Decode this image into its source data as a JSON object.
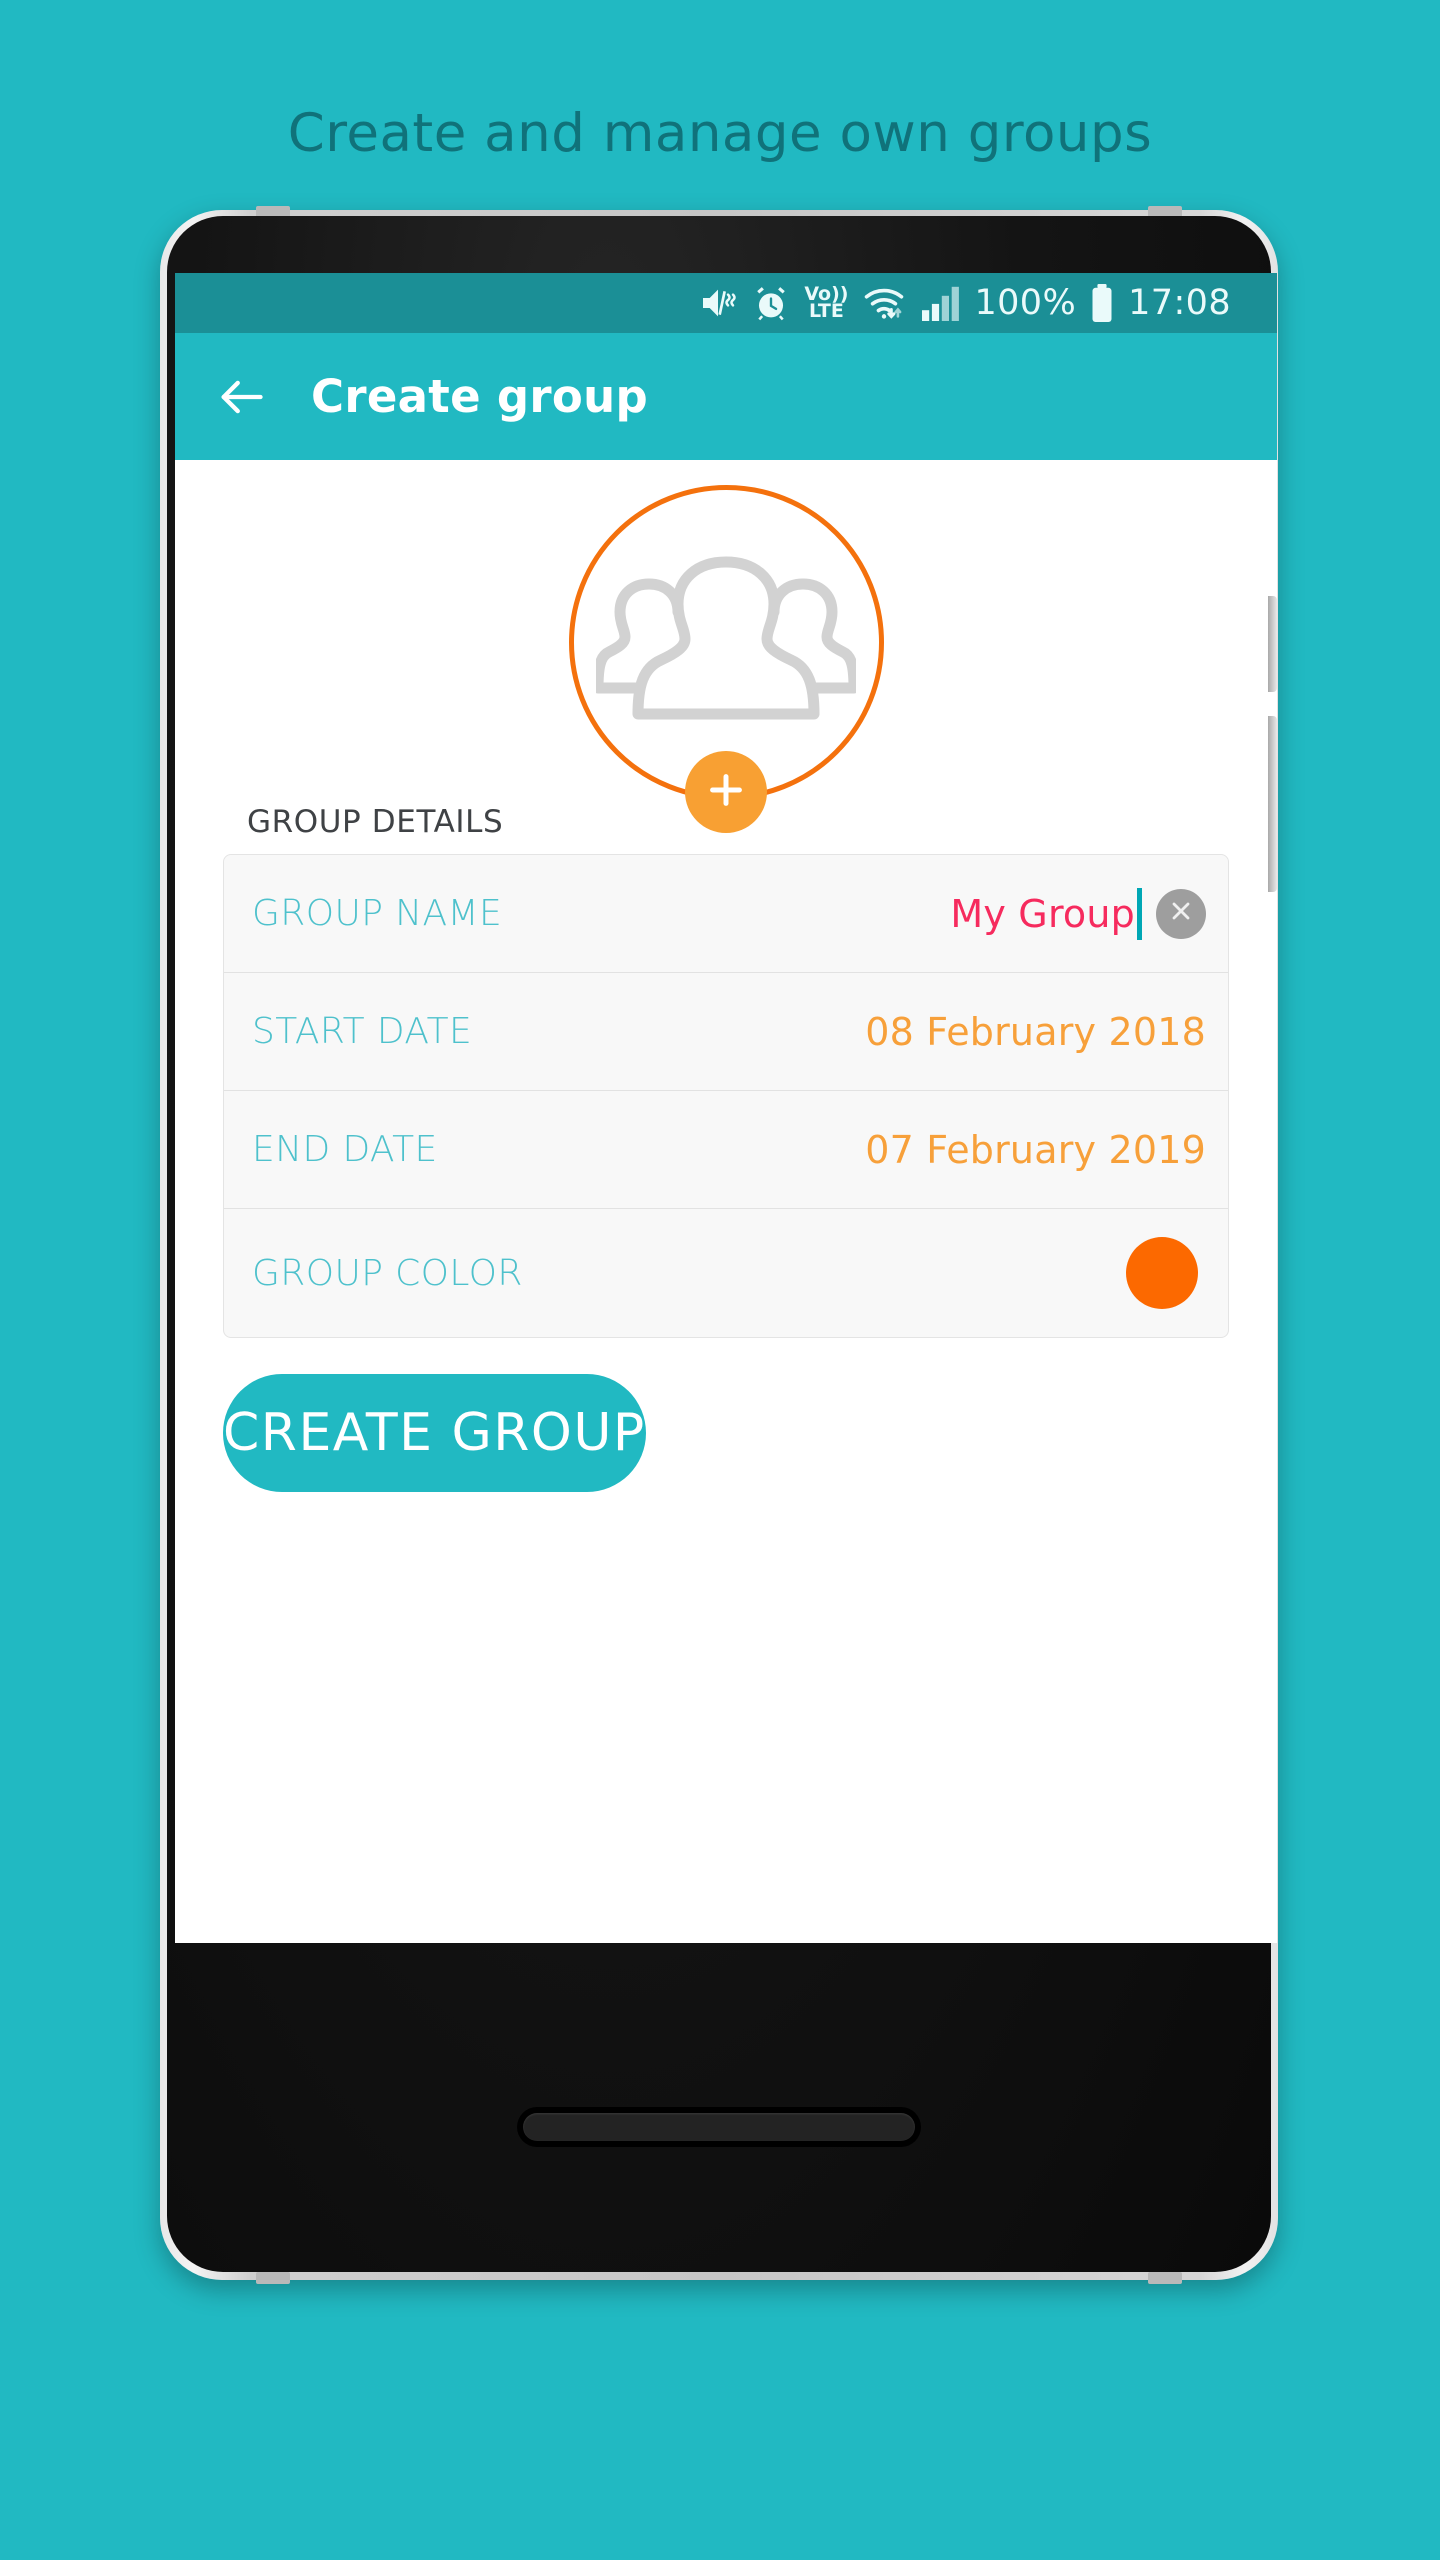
{
  "page": {
    "headline": "Create and manage own groups",
    "background_color": "#21b9c2",
    "headline_color": "#10727a"
  },
  "statusbar": {
    "background_color": "#1b8f96",
    "icons": [
      "mute-vibrate-icon",
      "alarm-icon",
      "volte-icon",
      "wifi-icon",
      "signal-bars-icon",
      "battery-icon"
    ],
    "volte_top": "Vo))",
    "volte_bottom": "LTE",
    "battery_percent": "100%",
    "time": "17:08"
  },
  "appbar": {
    "back_icon": "arrow-left-icon",
    "title": "Create group",
    "background_color": "#21b9c2",
    "title_color": "#ffffff"
  },
  "avatar": {
    "icon": "group-people-icon",
    "ring_color": "#f4710d",
    "silhouette_color": "#d2d2d2",
    "add_button": {
      "icon": "plus-icon",
      "background_color": "#f8a033"
    }
  },
  "form": {
    "section_title": "GROUP DETAILS",
    "rows": [
      {
        "name": "group-name",
        "label": "GROUP NAME",
        "value": "My Group",
        "value_color": "#f62b5e",
        "has_clear": true,
        "has_caret": true,
        "clear_icon": "close-icon"
      },
      {
        "name": "start-date",
        "label": "START DATE",
        "value": "08 February 2018",
        "value_color": "#f7a03a",
        "has_clear": false,
        "has_caret": false
      },
      {
        "name": "end-date",
        "label": "END DATE",
        "value": "07 February 2019",
        "value_color": "#f7a03a",
        "has_clear": false,
        "has_caret": false
      },
      {
        "name": "group-color",
        "label": "GROUP COLOR",
        "value": "",
        "swatch_color": "#fc6900",
        "has_swatch": true
      }
    ],
    "label_color": "#4ec1cc"
  },
  "cta": {
    "label": "CREATE GROUP",
    "background_color": "#21b9c2",
    "text_color": "#ffffff"
  }
}
